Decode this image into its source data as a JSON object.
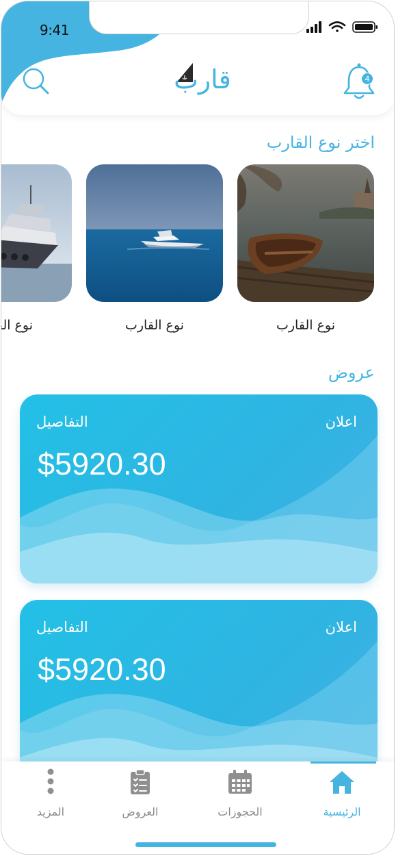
{
  "status_bar": {
    "time": "9:41"
  },
  "header": {
    "logo_text": "قارب",
    "notification_count": "4"
  },
  "boat_types": {
    "title": "اختر نوع القارب",
    "items": [
      {
        "label": "نوع القارب",
        "image": "rowboat-lake-photo"
      },
      {
        "label": "نوع القارب",
        "image": "speedboat-sea-photo"
      },
      {
        "label": "نوع القارب",
        "image": "yacht-photo"
      }
    ]
  },
  "offers": {
    "title": "عروض",
    "cards": [
      {
        "tag": "اعلان",
        "details_label": "التفاصيل",
        "price": "$5920.30"
      },
      {
        "tag": "اعلان",
        "details_label": "التفاصيل",
        "price": "$5920.30"
      }
    ]
  },
  "tabbar": {
    "items": [
      {
        "label": "الرئيسية",
        "icon": "home-icon",
        "active": true
      },
      {
        "label": "الحجوزات",
        "icon": "calendar-icon",
        "active": false
      },
      {
        "label": "العروض",
        "icon": "clipboard-icon",
        "active": false
      },
      {
        "label": "المزيد",
        "icon": "more-vertical-icon",
        "active": false
      }
    ]
  },
  "colors": {
    "accent": "#45b4e0",
    "card_gradient_start": "#23c0e6",
    "card_gradient_end": "#46b0e4"
  }
}
